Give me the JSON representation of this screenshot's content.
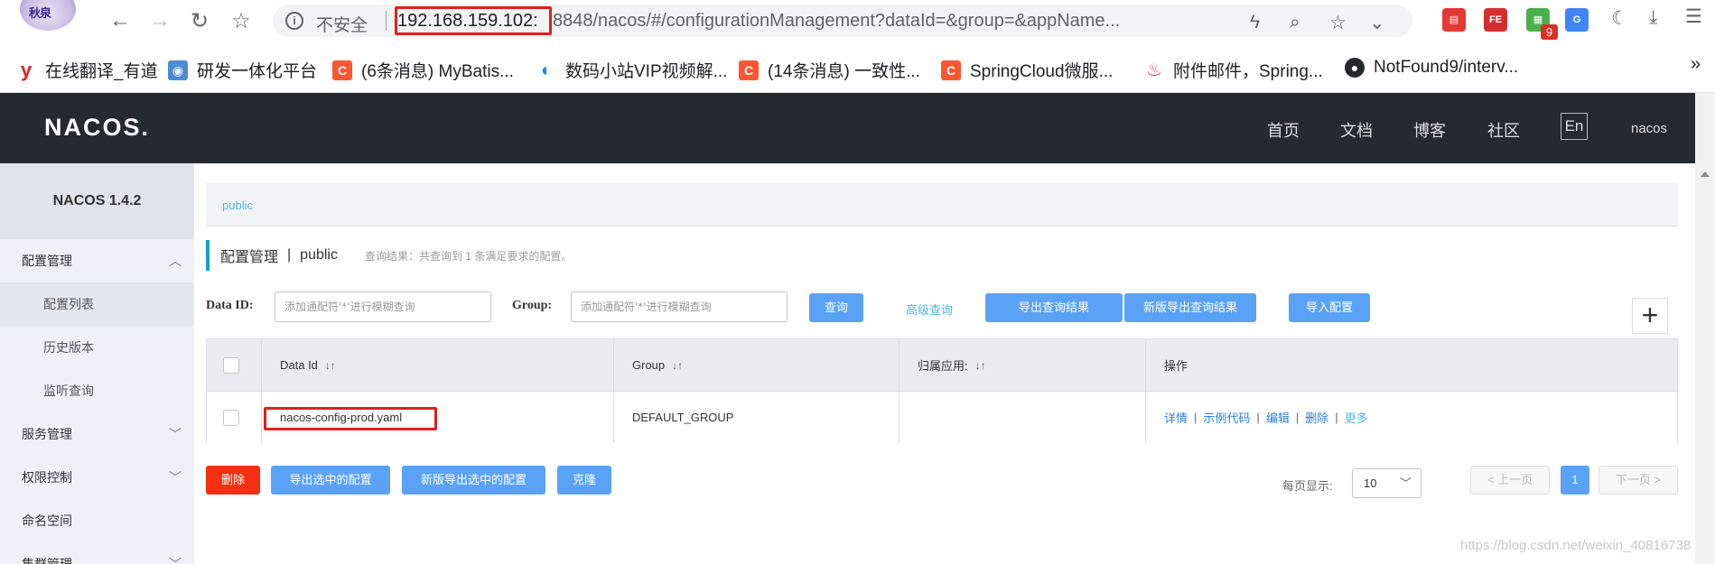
{
  "browser": {
    "address_insecure": "不安全",
    "address_host": "192.168.159.102:",
    "address_rest": "8848/nacos/#/configurationManagement?dataId=&group=&appName...",
    "extension_badge": "9",
    "bookmarks": [
      {
        "label": "在线翻译_有道",
        "icon": "youdao-icon",
        "color": "#e02020",
        "glyph": "y"
      },
      {
        "label": "研发一体化平台",
        "icon": "devops-icon",
        "color": "#4b8bd6",
        "glyph": "◉"
      },
      {
        "label": "(6条消息) MyBatis...",
        "icon": "csdn-icon",
        "color": "#fc5531",
        "glyph": "C"
      },
      {
        "label": "数码小站VIP视频解...",
        "icon": "video-icon",
        "color": "#1e88e5",
        "glyph": "◐"
      },
      {
        "label": "(14条消息) 一致性...",
        "icon": "csdn-icon",
        "color": "#fc5531",
        "glyph": "C"
      },
      {
        "label": "SpringCloud微服...",
        "icon": "csdn-icon",
        "color": "#fc5531",
        "glyph": "C"
      },
      {
        "label": "附件邮件，Spring...",
        "icon": "flame-icon",
        "color": "#ffffff",
        "glyph": "🔥"
      },
      {
        "label": "NotFound9/interv...",
        "icon": "github-icon",
        "color": "#24292e",
        "glyph": "●"
      }
    ],
    "overflow": "»"
  },
  "header": {
    "logo": "NACOS.",
    "nav": [
      "首页",
      "文档",
      "博客",
      "社区"
    ],
    "lang": "En",
    "user": "nacos"
  },
  "sidebar": {
    "title": "NACOS 1.4.2",
    "items": [
      {
        "label": "配置管理",
        "type": "group",
        "chevron": "up"
      },
      {
        "label": "配置列表",
        "type": "sub",
        "active": true
      },
      {
        "label": "历史版本",
        "type": "sub"
      },
      {
        "label": "监听查询",
        "type": "sub"
      },
      {
        "label": "服务管理",
        "type": "group",
        "chevron": "down"
      },
      {
        "label": "权限控制",
        "type": "group",
        "chevron": "down"
      },
      {
        "label": "命名空间",
        "type": "group"
      },
      {
        "label": "集群管理",
        "type": "group",
        "chevron": "down"
      }
    ]
  },
  "main": {
    "namespace_tab": "public",
    "title": "配置管理",
    "title_sep": "|",
    "title_ns": "public",
    "result_text": "查询结果：共查询到 1 条满足要求的配置。",
    "search": {
      "dataid_label": "Data ID:",
      "dataid_placeholder": "添加通配符'*'进行模糊查询",
      "group_label": "Group:",
      "group_placeholder": "添加通配符'*'进行模糊查询",
      "query_btn": "查询",
      "advanced_link": "高级查询",
      "export_btn": "导出查询结果",
      "export_new_btn": "新版导出查询结果",
      "import_btn": "导入配置",
      "add_btn": "+"
    },
    "table": {
      "headers": [
        "Data Id",
        "Group",
        "归属应用:",
        "操作"
      ],
      "sort_glyph": "↓↑",
      "rows": [
        {
          "data_id": "nacos-config-prod.yaml",
          "group": "DEFAULT_GROUP",
          "app": "",
          "ops": [
            "详情",
            "示例代码",
            "编辑",
            "删除"
          ],
          "more": "更多"
        }
      ]
    },
    "bottom": {
      "delete_btn": "删除",
      "export_selected_btn": "导出选中的配置",
      "export_selected_new_btn": "新版导出选中的配置",
      "clone_btn": "克隆",
      "page_size_label": "每页显示:",
      "page_size": "10",
      "prev": "< 上一页",
      "current_page": "1",
      "next": "下一页 >"
    }
  },
  "watermark": "https://blog.csdn.net/weixin_40816738",
  "colors": {
    "accent": "#5aa2f5",
    "danger": "#f52f12",
    "header_bg": "#252a2f",
    "highlight_box": "#e0201b"
  }
}
